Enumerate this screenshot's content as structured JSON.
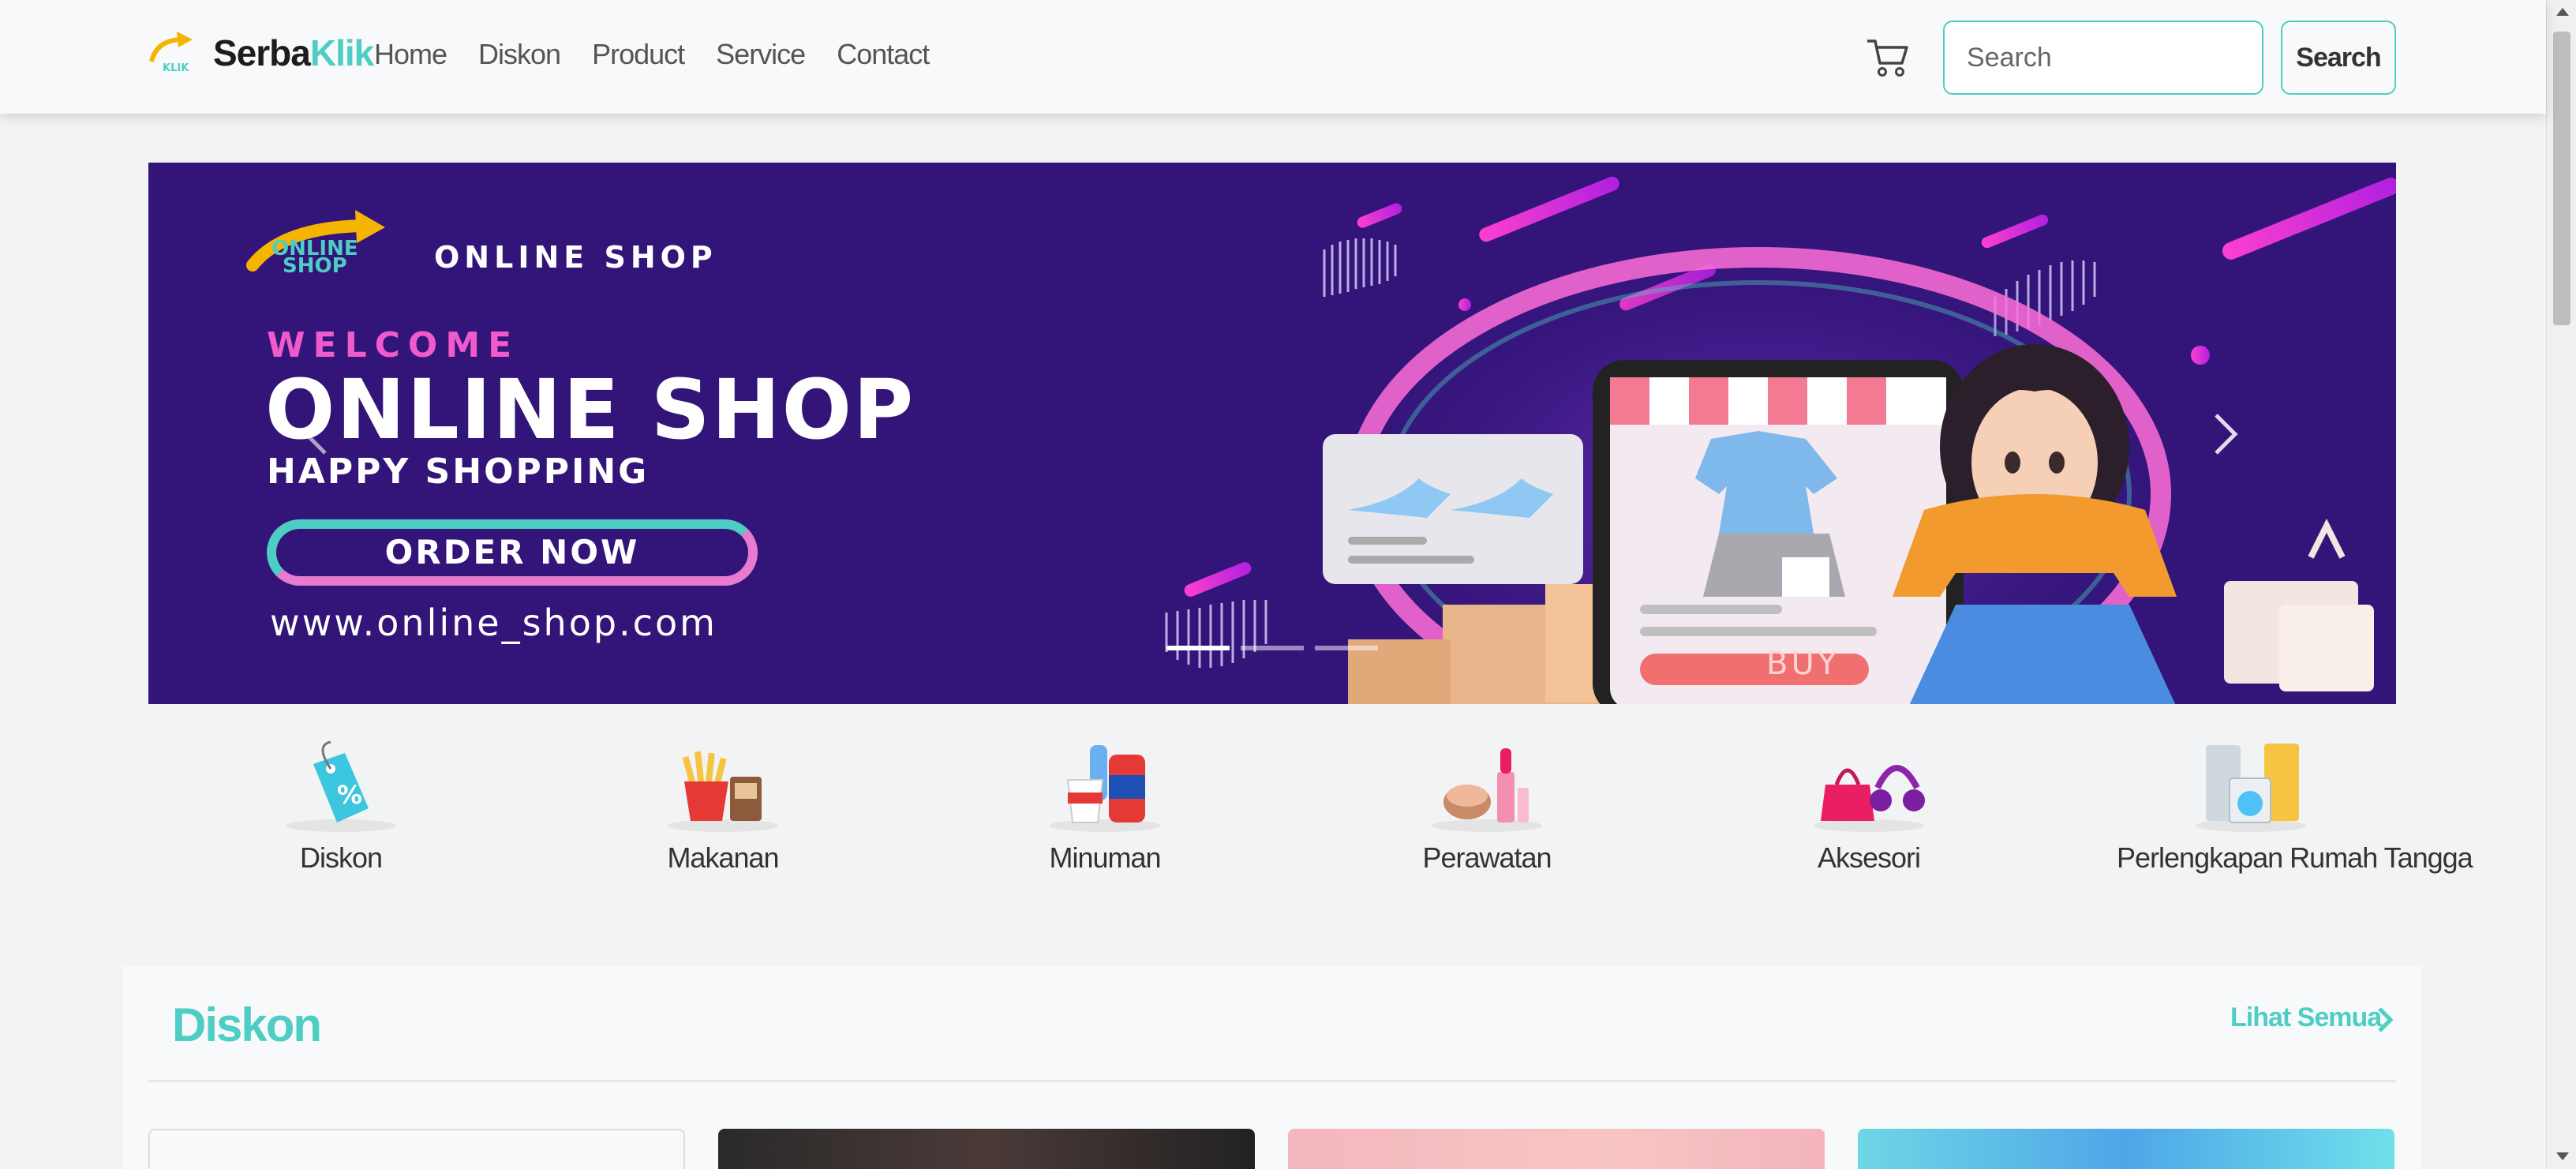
{
  "brand": {
    "name_part1": "Serba",
    "name_part2": "Klik",
    "logo_text": "KLIK"
  },
  "nav": {
    "items": [
      "Home",
      "Diskon",
      "Product",
      "Service",
      "Contact"
    ]
  },
  "search": {
    "placeholder": "Search",
    "button_label": "Search"
  },
  "banner": {
    "logo_line1": "ONLINE",
    "logo_line2": "SHOP",
    "shop_name": "ONLINE SHOP",
    "welcome": "WELCOME",
    "title": "ONLINE SHOP",
    "tagline": "HAPPY SHOPPING",
    "cta": "ORDER NOW",
    "url": "www.online_shop.com",
    "buy": "BUY",
    "indicators": 3,
    "active_indicator": 0
  },
  "categories": [
    {
      "label": "Diskon",
      "icon": "discount-tag-icon"
    },
    {
      "label": "Makanan",
      "icon": "food-icon"
    },
    {
      "label": "Minuman",
      "icon": "drink-icon"
    },
    {
      "label": "Perawatan",
      "icon": "cosmetics-icon"
    },
    {
      "label": "Aksesori",
      "icon": "accessories-icon"
    },
    {
      "label": "Perlengkapan Rumah Tangga",
      "icon": "home-appliance-icon"
    }
  ],
  "section": {
    "title": "Diskon",
    "see_all": "Lihat Semua"
  },
  "colors": {
    "accent": "#4ecdc4",
    "banner_bg": "#33157a",
    "pink": "#f05acb",
    "page_bg": "#f2f3f4"
  }
}
